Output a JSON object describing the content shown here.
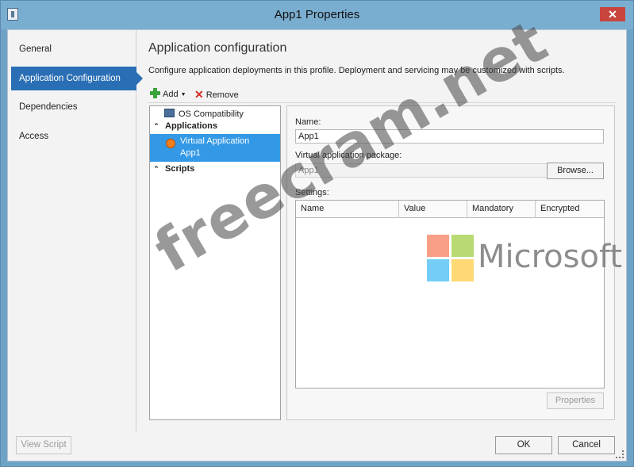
{
  "window": {
    "title": "App1 Properties",
    "close_glyph": "✕",
    "icon": "properties-icon"
  },
  "nav": {
    "items": [
      {
        "label": "General"
      },
      {
        "label": "Application Configuration",
        "active": true
      },
      {
        "label": "Dependencies"
      },
      {
        "label": "Access"
      }
    ]
  },
  "main": {
    "heading": "Application configuration",
    "description": "Configure application deployments in this profile. Deployment and servicing may be customized with scripts."
  },
  "toolbar": {
    "add_label": "Add",
    "remove_label": "Remove"
  },
  "tree": {
    "os_compatibility": "OS Compatibility",
    "applications_group": "Applications",
    "selected_app_line1": "Virtual Application",
    "selected_app_line2": "App1",
    "scripts_group": "Scripts"
  },
  "detail": {
    "name_label": "Name:",
    "name_value": "App1",
    "package_label": "Virtual application package:",
    "package_value": "App1",
    "browse_label": "Browse...",
    "settings_label": "Settings:",
    "columns": [
      "Name",
      "Value",
      "Mandatory",
      "Encrypted"
    ],
    "properties_label": "Properties"
  },
  "footer": {
    "view_script_label": "View Script",
    "ok_label": "OK",
    "cancel_label": "Cancel"
  },
  "overlay": {
    "watermark": "freecram.net",
    "brand_text": "Microsoft",
    "brand_colors": [
      "#f25022",
      "#7fba00",
      "#00a4ef",
      "#ffb900"
    ]
  },
  "colors": {
    "titlebar": "#7aaed0",
    "nav_active": "#2a6fb5",
    "tree_selected": "#3399e6"
  }
}
